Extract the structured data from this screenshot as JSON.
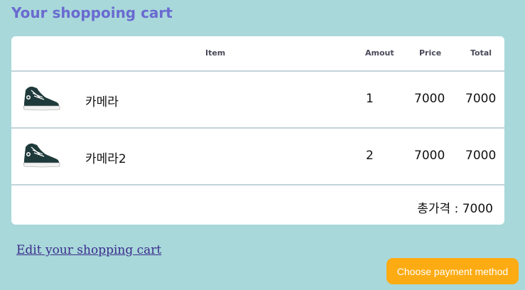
{
  "page": {
    "title": "Your shoppoing cart"
  },
  "cart": {
    "headers": {
      "item": "Item",
      "amount": "Amout",
      "price": "Price",
      "total": "Total"
    },
    "rows": [
      {
        "image_icon": "sneaker-icon",
        "name": "카메라",
        "amount": "1",
        "price": "7000",
        "total": "7000"
      },
      {
        "image_icon": "sneaker-icon",
        "name": "카메라2",
        "amount": "2",
        "price": "7000",
        "total": "7000"
      }
    ],
    "total_line": "총가격 : 7000"
  },
  "actions": {
    "edit_link": "Edit your shopping cart",
    "payment_button": "Choose payment method"
  },
  "colors": {
    "background": "#a8d8da",
    "title": "#6a6ad0",
    "button": "#fdab12",
    "link": "#3b2c8c",
    "divider": "#c3d3da"
  }
}
